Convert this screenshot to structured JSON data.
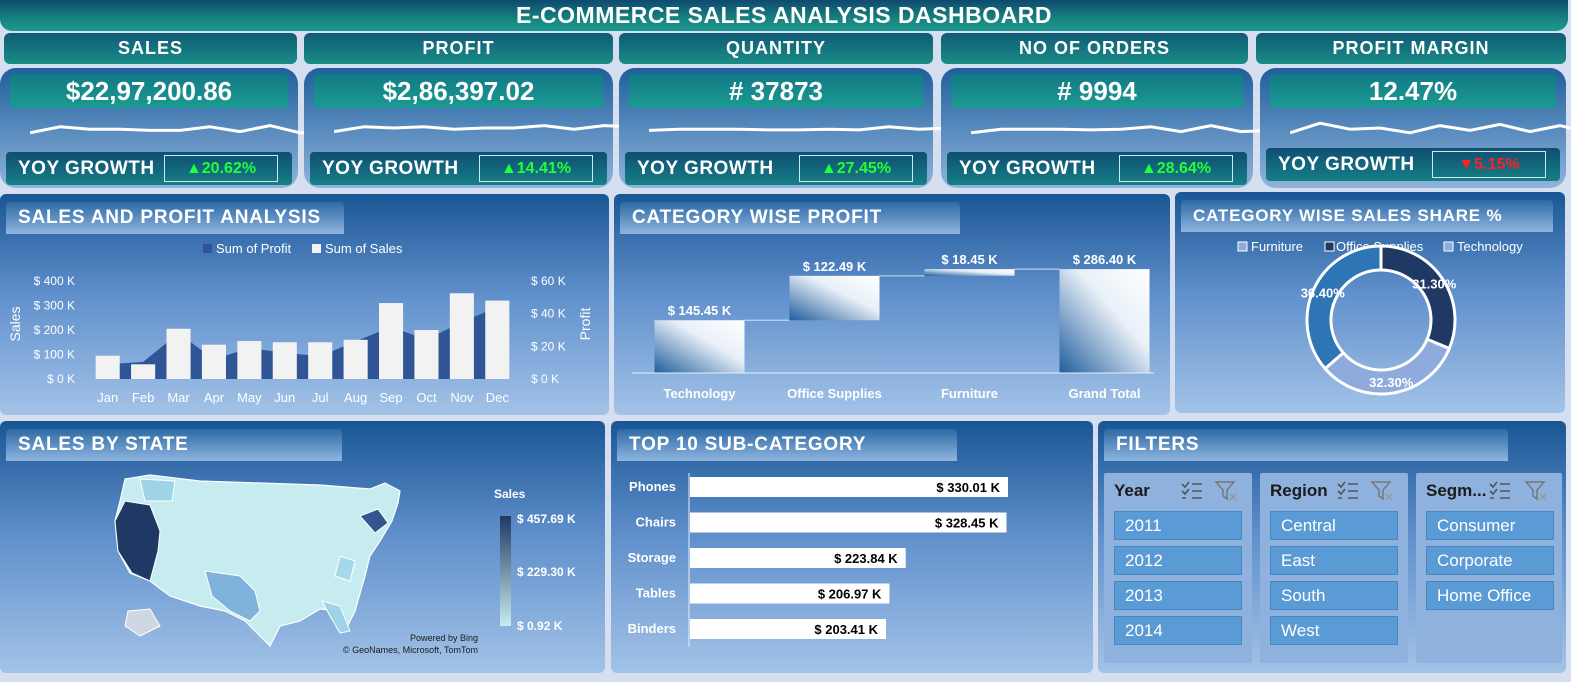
{
  "title": "E-COMMERCE SALES ANALYSIS DASHBOARD",
  "kpis": [
    {
      "header": "SALES",
      "value": "$22,97,200.86",
      "yoy_label": "YOY GROWTH",
      "yoy": "▲20.62%",
      "trend": "up",
      "spark": [
        0.3,
        0.55,
        0.45,
        0.45,
        0.4,
        0.4,
        0.55,
        0.35,
        0.6,
        0.3,
        0.35
      ]
    },
    {
      "header": "PROFIT",
      "value": "$2,86,397.02",
      "yoy_label": "YOY GROWTH",
      "yoy": "▲14.41%",
      "trend": "up",
      "spark": [
        0.35,
        0.55,
        0.5,
        0.55,
        0.45,
        0.5,
        0.5,
        0.6,
        0.45,
        0.6,
        0.55
      ]
    },
    {
      "header": "QUANTITY",
      "value": "# 37873",
      "yoy_label": "YOY GROWTH",
      "yoy": "▲27.45%",
      "trend": "up",
      "spark": [
        0.4,
        0.45,
        0.45,
        0.45,
        0.42,
        0.42,
        0.45,
        0.42,
        0.55,
        0.45,
        0.5
      ]
    },
    {
      "header": "NO OF ORDERS",
      "value": "# 9994",
      "yoy_label": "YOY GROWTH",
      "yoy": "▲28.64%",
      "trend": "up",
      "spark": [
        0.3,
        0.45,
        0.45,
        0.45,
        0.42,
        0.45,
        0.55,
        0.35,
        0.6,
        0.35,
        0.4
      ]
    },
    {
      "header": "PROFIT MARGIN",
      "value": "12.47%",
      "yoy_label": "YOY GROWTH",
      "yoy": "▼5.15%",
      "trend": "down",
      "spark": [
        0.3,
        0.7,
        0.45,
        0.5,
        0.3,
        0.6,
        0.4,
        0.65,
        0.35,
        0.6,
        0.3
      ]
    }
  ],
  "sales_profit": {
    "title": "SALES AND PROFIT ANALYSIS",
    "legend_profit": "Sum of Profit",
    "legend_sales": "Sum of Sales",
    "y_left_label": "Sales",
    "y_right_label": "Profit",
    "left_ticks": [
      "$ 0 K",
      "$ 100 K",
      "$ 200 K",
      "$ 300 K",
      "$ 400 K"
    ],
    "right_ticks": [
      "$ 0 K",
      "$ 20 K",
      "$ 40 K",
      "$ 60 K"
    ],
    "colors": {
      "sales": "#f2f2f2",
      "profit": "#2f5597"
    }
  },
  "category_profit": {
    "title": "CATEGORY WISE PROFIT"
  },
  "sales_share": {
    "title": "CATEGORY WISE SALES SHARE %",
    "legend": [
      "Furniture",
      "Office Supplies",
      "Technology"
    ]
  },
  "state_map": {
    "title": "SALES BY STATE",
    "legend_title": "Sales",
    "legend_max": "$ 457.69 K",
    "legend_mid": "$ 229.30 K",
    "legend_min": "$ 0.92 K",
    "credit1": "Powered by Bing",
    "credit2": "© GeoNames, Microsoft, TomTom"
  },
  "subcategory": {
    "title": "TOP 10 SUB-CATEGORY"
  },
  "filters": {
    "title": "FILTERS",
    "groups": [
      {
        "name": "Year",
        "items": [
          "2011",
          "2012",
          "2013",
          "2014"
        ]
      },
      {
        "name": "Region",
        "items": [
          "Central",
          "East",
          "South",
          "West"
        ]
      },
      {
        "name": "Segm...",
        "items": [
          "Consumer",
          "Corporate",
          "Home Office"
        ]
      }
    ]
  },
  "chart_data": [
    {
      "type": "bar",
      "title": "SALES AND PROFIT ANALYSIS",
      "categories": [
        "Jan",
        "Feb",
        "Mar",
        "Apr",
        "May",
        "Jun",
        "Jul",
        "Aug",
        "Sep",
        "Oct",
        "Nov",
        "Dec"
      ],
      "series": [
        {
          "name": "Sum of Sales",
          "axis": "left",
          "values": [
            95000,
            60000,
            205000,
            140000,
            155000,
            150000,
            150000,
            160000,
            310000,
            200000,
            350000,
            320000
          ]
        },
        {
          "name": "Sum of Profit",
          "axis": "right",
          "type": "area",
          "values": [
            9000,
            10500,
            28000,
            12000,
            19000,
            16000,
            14000,
            23000,
            32000,
            24000,
            35000,
            44000
          ]
        }
      ],
      "ylabel": "Sales",
      "y2label": "Profit",
      "ylim": [
        0,
        400000
      ],
      "y2lim": [
        0,
        60000
      ]
    },
    {
      "type": "bar",
      "subtype": "waterfall",
      "title": "CATEGORY WISE PROFIT",
      "categories": [
        "Technology",
        "Office Supplies",
        "Furniture",
        "Grand Total"
      ],
      "values": [
        145.45,
        122.49,
        18.45,
        286.4
      ],
      "labels": [
        "$ 145.45 K",
        "$ 122.49 K",
        "$ 18.45 K",
        "$ 286.40 K"
      ],
      "unit": "K",
      "ylim": [
        0,
        300
      ]
    },
    {
      "type": "pie",
      "subtype": "donut",
      "title": "CATEGORY WISE SALES SHARE %",
      "categories": [
        "Technology",
        "Office Supplies",
        "Furniture"
      ],
      "values": [
        36.4,
        31.3,
        32.3
      ],
      "labels": [
        "36.40%",
        "31.30%",
        "32.30%"
      ],
      "colors": [
        "#2e75b6",
        "#203864",
        "#8faadc"
      ]
    },
    {
      "type": "bar",
      "orientation": "horizontal",
      "title": "TOP 10 SUB-CATEGORY",
      "categories": [
        "Phones",
        "Chairs",
        "Storage",
        "Tables",
        "Binders"
      ],
      "values": [
        330.01,
        328.45,
        223.84,
        206.97,
        203.41
      ],
      "labels": [
        "$ 330.01 K",
        "$ 328.45 K",
        "$ 223.84 K",
        "$ 206.97 K",
        "$ 203.41 K"
      ],
      "unit": "K"
    }
  ]
}
